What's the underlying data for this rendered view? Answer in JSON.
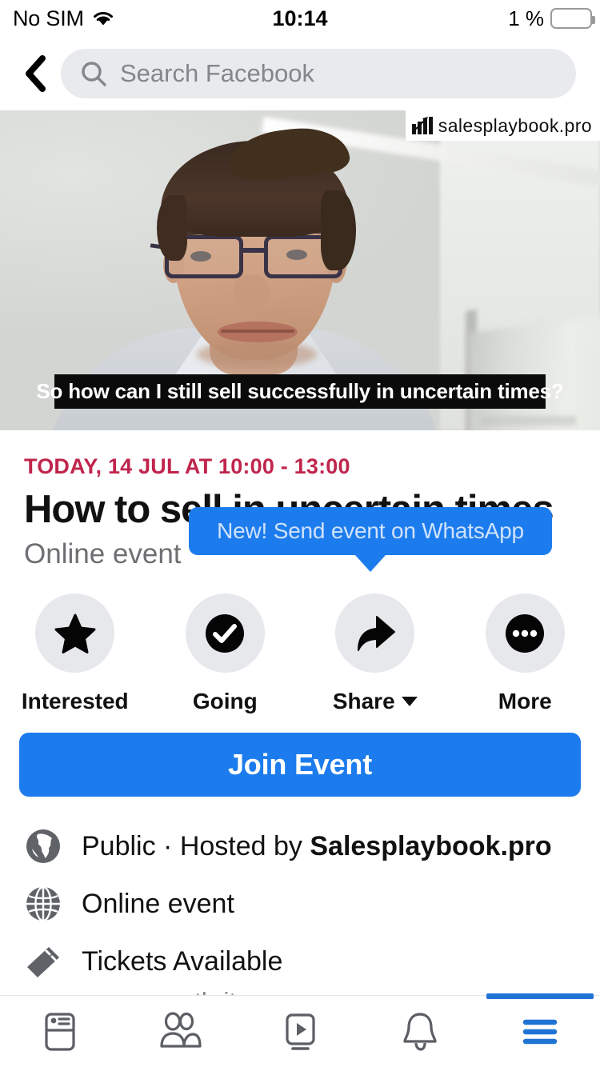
{
  "status_bar": {
    "carrier": "No SIM",
    "wifi_icon": "wifi-icon",
    "time": "10:14",
    "battery_percent": "1 %",
    "battery_icon": "battery-low-icon"
  },
  "header": {
    "back_icon": "back-chevron-icon",
    "search_icon": "search-icon",
    "search_placeholder": "Search Facebook",
    "search_value": ""
  },
  "cover": {
    "media_type": "video",
    "caption": "So how can I still sell successfully in uncertain times?",
    "watermark_text": "salesplaybook.pro",
    "watermark_icon": "bar-chart-logo-icon"
  },
  "event": {
    "date": "TODAY, 14 JUL AT 10:00 - 13:00",
    "date_color": "#C0254C",
    "title": "How to sell in uncertain times",
    "subtitle": "Online event"
  },
  "tooltip": {
    "text": "New! Send event on WhatsApp",
    "color": "#1C7CED"
  },
  "actions": [
    {
      "label": "Interested",
      "icon": "star-icon",
      "has_caret": false
    },
    {
      "label": "Going",
      "icon": "check-circle-icon",
      "has_caret": false
    },
    {
      "label": "Share",
      "icon": "share-arrow-icon",
      "has_caret": true
    },
    {
      "label": "More",
      "icon": "ellipsis-circle-icon",
      "has_caret": false
    }
  ],
  "join_button": {
    "label": "Join Event",
    "color": "#1C7CED"
  },
  "info_rows": [
    {
      "icon": "globe-africa-icon",
      "text_prefix": "Public · Hosted by ",
      "text_bold": "Salesplaybook.pro",
      "sub": ""
    },
    {
      "icon": "globe-grid-icon",
      "text_prefix": "Online event",
      "text_bold": "",
      "sub": ""
    },
    {
      "icon": "ticket-icon",
      "text_prefix": "Tickets Available",
      "text_bold": "",
      "sub": "www.eventbrite.com"
    }
  ],
  "bottom_nav": {
    "active_color": "#1F73D4",
    "items": [
      {
        "name": "news-feed-icon",
        "active": false
      },
      {
        "name": "friends-icon",
        "active": false
      },
      {
        "name": "watch-video-icon",
        "active": false
      },
      {
        "name": "notifications-bell-icon",
        "active": false
      },
      {
        "name": "menu-hamburger-icon",
        "active": true
      }
    ]
  }
}
